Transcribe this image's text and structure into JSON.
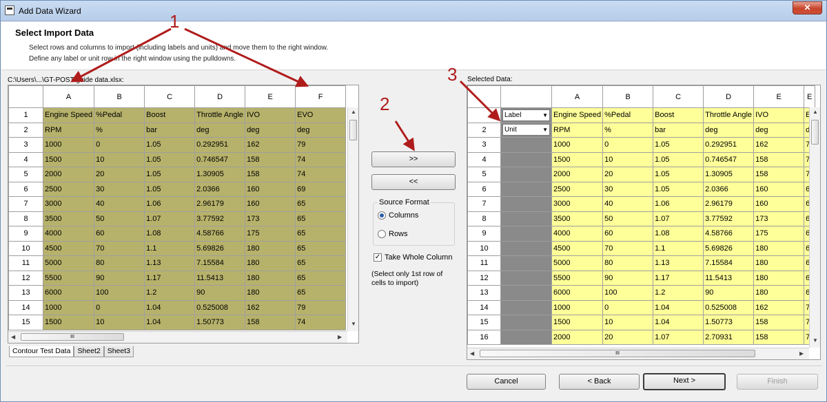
{
  "window": {
    "title": "Add Data Wizard",
    "close_glyph": "✕"
  },
  "header": {
    "title": "Select Import Data",
    "line1": "Select rows and columns to import (including labels and units) and move them to the right window.",
    "line2": "Define any label or unit row in the right window using the pulldowns."
  },
  "file_path": "C:\\Users\\...\\GT-POST guide data.xlsx:",
  "selected_label": "Selected Data:",
  "left_grid": {
    "columns": [
      "A",
      "B",
      "C",
      "D",
      "E",
      "F"
    ],
    "rows": [
      {
        "n": "1",
        "cells": [
          "Engine Speed",
          "%Pedal",
          "Boost",
          "Throttle Angle",
          "IVO",
          "EVO"
        ]
      },
      {
        "n": "2",
        "cells": [
          "RPM",
          "%",
          "bar",
          "deg",
          "deg",
          "deg"
        ]
      },
      {
        "n": "3",
        "cells": [
          "1000",
          "0",
          "1.05",
          "0.292951",
          "162",
          "79"
        ]
      },
      {
        "n": "4",
        "cells": [
          "1500",
          "10",
          "1.05",
          "0.746547",
          "158",
          "74"
        ]
      },
      {
        "n": "5",
        "cells": [
          "2000",
          "20",
          "1.05",
          "1.30905",
          "158",
          "74"
        ]
      },
      {
        "n": "6",
        "cells": [
          "2500",
          "30",
          "1.05",
          "2.0366",
          "160",
          "69"
        ]
      },
      {
        "n": "7",
        "cells": [
          "3000",
          "40",
          "1.06",
          "2.96179",
          "160",
          "65"
        ]
      },
      {
        "n": "8",
        "cells": [
          "3500",
          "50",
          "1.07",
          "3.77592",
          "173",
          "65"
        ]
      },
      {
        "n": "9",
        "cells": [
          "4000",
          "60",
          "1.08",
          "4.58766",
          "175",
          "65"
        ]
      },
      {
        "n": "10",
        "cells": [
          "4500",
          "70",
          "1.1",
          "5.69826",
          "180",
          "65"
        ]
      },
      {
        "n": "11",
        "cells": [
          "5000",
          "80",
          "1.13",
          "7.15584",
          "180",
          "65"
        ]
      },
      {
        "n": "12",
        "cells": [
          "5500",
          "90",
          "1.17",
          "11.5413",
          "180",
          "65"
        ]
      },
      {
        "n": "13",
        "cells": [
          "6000",
          "100",
          "1.2",
          "90",
          "180",
          "65"
        ]
      },
      {
        "n": "14",
        "cells": [
          "1000",
          "0",
          "1.04",
          "0.525008",
          "162",
          "79"
        ]
      },
      {
        "n": "15",
        "cells": [
          "1500",
          "10",
          "1.04",
          "1.50773",
          "158",
          "74"
        ]
      }
    ]
  },
  "sheet_tabs": [
    "Contour Test Data",
    "Sheet2",
    "Sheet3"
  ],
  "middle": {
    "add_button": ">>",
    "remove_button": "<<",
    "source_format_title": "Source Format",
    "opt_columns": "Columns",
    "opt_rows": "Rows",
    "selected_format": "Columns",
    "take_whole_column": "Take Whole Column",
    "take_whole_column_checked": true,
    "note_line1": "(Select only 1st row of",
    "note_line2": "cells to import)"
  },
  "right_grid": {
    "columns": [
      "A",
      "B",
      "C",
      "D",
      "E",
      "E"
    ],
    "row1_selector": "Label",
    "row2_selector": "Unit",
    "rows": [
      {
        "n": "",
        "cells": [
          "Engine Speed",
          "%Pedal",
          "Boost",
          "Throttle Angle",
          "IVO",
          "E"
        ]
      },
      {
        "n": "2",
        "cells": [
          "RPM",
          "%",
          "bar",
          "deg",
          "deg",
          "d"
        ]
      },
      {
        "n": "3",
        "cells": [
          "1000",
          "0",
          "1.05",
          "0.292951",
          "162",
          "7"
        ]
      },
      {
        "n": "4",
        "cells": [
          "1500",
          "10",
          "1.05",
          "0.746547",
          "158",
          "7"
        ]
      },
      {
        "n": "5",
        "cells": [
          "2000",
          "20",
          "1.05",
          "1.30905",
          "158",
          "7"
        ]
      },
      {
        "n": "6",
        "cells": [
          "2500",
          "30",
          "1.05",
          "2.0366",
          "160",
          "6"
        ]
      },
      {
        "n": "7",
        "cells": [
          "3000",
          "40",
          "1.06",
          "2.96179",
          "160",
          "6"
        ]
      },
      {
        "n": "8",
        "cells": [
          "3500",
          "50",
          "1.07",
          "3.77592",
          "173",
          "6"
        ]
      },
      {
        "n": "9",
        "cells": [
          "4000",
          "60",
          "1.08",
          "4.58766",
          "175",
          "6"
        ]
      },
      {
        "n": "10",
        "cells": [
          "4500",
          "70",
          "1.1",
          "5.69826",
          "180",
          "6"
        ]
      },
      {
        "n": "11",
        "cells": [
          "5000",
          "80",
          "1.13",
          "7.15584",
          "180",
          "6"
        ]
      },
      {
        "n": "12",
        "cells": [
          "5500",
          "90",
          "1.17",
          "11.5413",
          "180",
          "6"
        ]
      },
      {
        "n": "13",
        "cells": [
          "6000",
          "100",
          "1.2",
          "90",
          "180",
          "6"
        ]
      },
      {
        "n": "14",
        "cells": [
          "1000",
          "0",
          "1.04",
          "0.525008",
          "162",
          "7"
        ]
      },
      {
        "n": "15",
        "cells": [
          "1500",
          "10",
          "1.04",
          "1.50773",
          "158",
          "7"
        ]
      },
      {
        "n": "16",
        "cells": [
          "2000",
          "20",
          "1.07",
          "2.70931",
          "158",
          "7"
        ]
      }
    ]
  },
  "footer": {
    "cancel": "Cancel",
    "back": "< Back",
    "next": "Next >",
    "finish": "Finish"
  },
  "annotations": {
    "a1": "1",
    "a2": "2",
    "a3": "3",
    "color": "#b01c1c"
  },
  "colors": {
    "left_cells": "#b7b26b",
    "right_cells": "#ffff99",
    "selector_column": "#8a8a8a"
  },
  "scroll_glyph": "III"
}
